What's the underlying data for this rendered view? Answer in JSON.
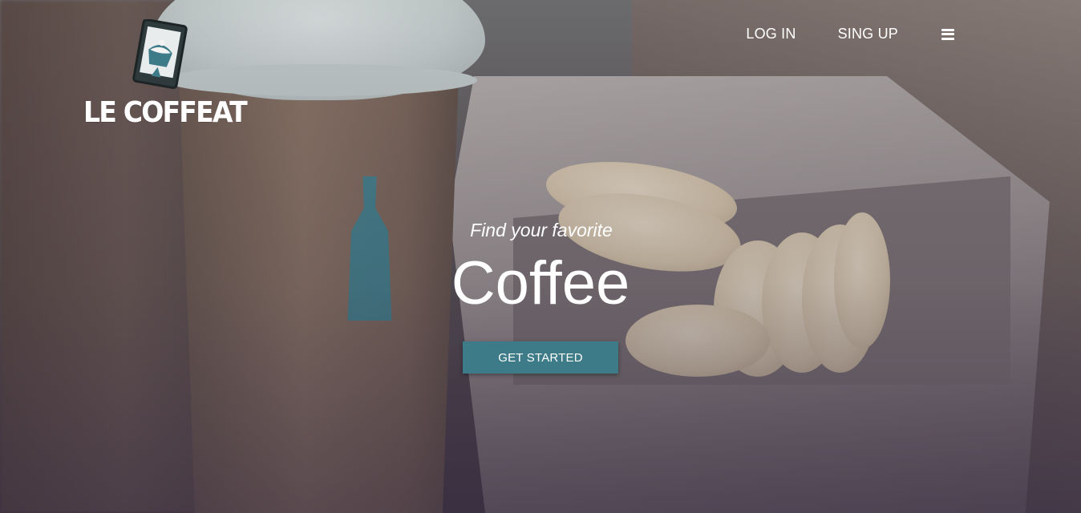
{
  "brand": {
    "name": "LE COFFEAT",
    "icon": "cupcake-tablet-icon",
    "accent_color": "#3c7b87"
  },
  "nav": {
    "login_label": "LOG IN",
    "signup_label": "SING UP",
    "menu_icon": "hamburger-menu-icon"
  },
  "hero": {
    "tagline": "Find your favorite",
    "headline": "Coffee",
    "cta_label": "GET STARTED"
  }
}
